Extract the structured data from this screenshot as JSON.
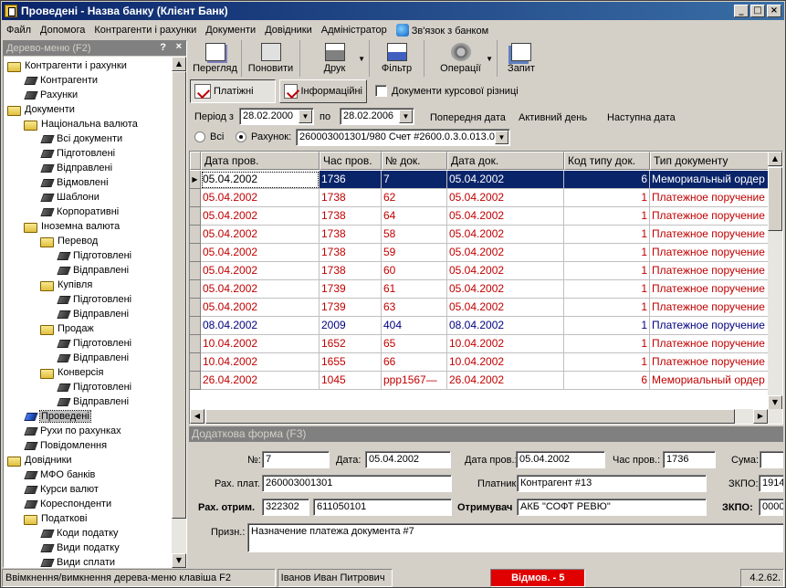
{
  "window": {
    "title": "Проведені - Назва банку (Клієнт Банк)",
    "buttons": [
      "_",
      "□",
      "×"
    ]
  },
  "menu": [
    "Файл",
    "Допомога",
    "Контрагенти і рахунки",
    "Документи",
    "Довідники",
    "Адміністратор",
    "Зв'язок з банком"
  ],
  "tree": {
    "header": "Дерево-меню (F2)",
    "help": "?",
    "close": "×",
    "items": [
      {
        "label": "Контрагенти і рахунки",
        "icon": "folder-icon",
        "level": 0
      },
      {
        "label": "Контрагенти",
        "icon": "book-icon",
        "level": 1
      },
      {
        "label": "Рахунки",
        "icon": "book-icon",
        "level": 1
      },
      {
        "label": "Документи",
        "icon": "folder-icon",
        "level": 0
      },
      {
        "label": "Національна валюта",
        "icon": "folder-icon",
        "level": 1
      },
      {
        "label": "Всі документи",
        "icon": "book-icon",
        "level": 2
      },
      {
        "label": "Підготовлені",
        "icon": "book-icon",
        "level": 2
      },
      {
        "label": "Відправлені",
        "icon": "book-icon",
        "level": 2
      },
      {
        "label": "Відмовлені",
        "icon": "book-icon",
        "level": 2
      },
      {
        "label": "Шаблони",
        "icon": "book-icon",
        "level": 2
      },
      {
        "label": "Корпоративні",
        "icon": "book-icon",
        "level": 2
      },
      {
        "label": "Іноземна валюта",
        "icon": "folder-icon",
        "level": 1
      },
      {
        "label": "Перевод",
        "icon": "folder-icon",
        "level": 2
      },
      {
        "label": "Підготовлені",
        "icon": "book-icon",
        "level": 3
      },
      {
        "label": "Відправлені",
        "icon": "book-icon",
        "level": 3
      },
      {
        "label": "Купівля",
        "icon": "folder-icon",
        "level": 2
      },
      {
        "label": "Підготовлені",
        "icon": "book-icon",
        "level": 3
      },
      {
        "label": "Відправлені",
        "icon": "book-icon",
        "level": 3
      },
      {
        "label": "Продаж",
        "icon": "folder-icon",
        "level": 2
      },
      {
        "label": "Підготовлені",
        "icon": "book-icon",
        "level": 3
      },
      {
        "label": "Відправлені",
        "icon": "book-icon",
        "level": 3
      },
      {
        "label": "Конверсія",
        "icon": "folder-icon",
        "level": 2
      },
      {
        "label": "Підготовлені",
        "icon": "book-icon",
        "level": 3
      },
      {
        "label": "Відправлені",
        "icon": "book-icon",
        "level": 3
      },
      {
        "label": "Проведені",
        "icon": "blue-book-icon",
        "level": 1,
        "selected": true
      },
      {
        "label": "Рухи по рахунках",
        "icon": "book-icon",
        "level": 1
      },
      {
        "label": "Повідомлення",
        "icon": "book-icon",
        "level": 1
      },
      {
        "label": "Довідники",
        "icon": "folder-icon",
        "level": 0
      },
      {
        "label": "МФО банків",
        "icon": "book-icon",
        "level": 1
      },
      {
        "label": "Курси валют",
        "icon": "book-icon",
        "level": 1
      },
      {
        "label": "Кореспонденти",
        "icon": "book-icon",
        "level": 1
      },
      {
        "label": "Податкові",
        "icon": "folder-icon",
        "level": 1
      },
      {
        "label": "Коди податку",
        "icon": "book-icon",
        "level": 2
      },
      {
        "label": "Види податку",
        "icon": "book-icon",
        "level": 2
      },
      {
        "label": "Види сплати",
        "icon": "book-icon",
        "level": 2
      }
    ]
  },
  "toolbar": {
    "view": "Перегляд",
    "refresh": "Поновити",
    "print": "Друк",
    "filter": "Фільтр",
    "operations": "Операції",
    "query": "Запит",
    "dropdown_arrow": "▼"
  },
  "filters": {
    "tab_payment": "Платіжні",
    "tab_info": "Інформаційні",
    "exchange_docs": "Документи курсової різниці",
    "period_from_label": "Період з",
    "period_from": "28.02.2000",
    "period_to_label": "по",
    "period_to": "28.02.2006",
    "prev_date": "Попередня дата",
    "active_day": "Активний день",
    "next_date": "Наступна дата",
    "all_label": "Всі",
    "account_label": "Рахунок:",
    "account_value": "260003001301/980 Счет #2600.0.3.0.013.0"
  },
  "grid": {
    "columns": [
      "Дата пров.",
      "Час пров.",
      "№ док.",
      "Дата док.",
      "Код типу док.",
      "Тип документу"
    ],
    "rows": [
      {
        "date_prov": "05.04.2002",
        "time_prov": "1736",
        "doc_no": "7",
        "date_doc": "05.04.2002",
        "type_code": "6",
        "doc_type": "Мемориальный ордер",
        "color": "blue",
        "selected": true
      },
      {
        "date_prov": "05.04.2002",
        "time_prov": "1738",
        "doc_no": "62",
        "date_doc": "05.04.2002",
        "type_code": "1",
        "doc_type": "Платежное поручение",
        "color": "red"
      },
      {
        "date_prov": "05.04.2002",
        "time_prov": "1738",
        "doc_no": "64",
        "date_doc": "05.04.2002",
        "type_code": "1",
        "doc_type": "Платежное поручение",
        "color": "red"
      },
      {
        "date_prov": "05.04.2002",
        "time_prov": "1738",
        "doc_no": "58",
        "date_doc": "05.04.2002",
        "type_code": "1",
        "doc_type": "Платежное поручение",
        "color": "red"
      },
      {
        "date_prov": "05.04.2002",
        "time_prov": "1738",
        "doc_no": "59",
        "date_doc": "05.04.2002",
        "type_code": "1",
        "doc_type": "Платежное поручение",
        "color": "red"
      },
      {
        "date_prov": "05.04.2002",
        "time_prov": "1738",
        "doc_no": "60",
        "date_doc": "05.04.2002",
        "type_code": "1",
        "doc_type": "Платежное поручение",
        "color": "red"
      },
      {
        "date_prov": "05.04.2002",
        "time_prov": "1739",
        "doc_no": "61",
        "date_doc": "05.04.2002",
        "type_code": "1",
        "doc_type": "Платежное поручение",
        "color": "red"
      },
      {
        "date_prov": "05.04.2002",
        "time_prov": "1739",
        "doc_no": "63",
        "date_doc": "05.04.2002",
        "type_code": "1",
        "doc_type": "Платежное поручение",
        "color": "red"
      },
      {
        "date_prov": "08.04.2002",
        "time_prov": "2009",
        "doc_no": "404",
        "date_doc": "08.04.2002",
        "type_code": "1",
        "doc_type": "Платежное поручение",
        "color": "blue"
      },
      {
        "date_prov": "10.04.2002",
        "time_prov": "1652",
        "doc_no": "65",
        "date_doc": "10.04.2002",
        "type_code": "1",
        "doc_type": "Платежное поручение",
        "color": "red"
      },
      {
        "date_prov": "10.04.2002",
        "time_prov": "1655",
        "doc_no": "66",
        "date_doc": "10.04.2002",
        "type_code": "1",
        "doc_type": "Платежное поручение",
        "color": "red"
      },
      {
        "date_prov": "26.04.2002",
        "time_prov": "1045",
        "doc_no": "ррр1567—",
        "date_doc": "26.04.2002",
        "type_code": "6",
        "doc_type": "Мемориальный ордер",
        "color": "red"
      }
    ]
  },
  "details": {
    "header": "Додаткова форма (F3)",
    "no_label": "№:",
    "no_value": "7",
    "date_label": "Дата:",
    "date_value": "05.04.2002",
    "date_prov_label": "Дата пров.:",
    "date_prov_value": "05.04.2002",
    "time_prov_label": "Час пров.:",
    "time_prov_value": "1736",
    "sum_label": "Сума:",
    "sum_value": "",
    "payer_acc_label": "Рах. плат.",
    "payer_acc_value": "260003001301",
    "payer_label": "Платник",
    "payer_value": "Контрагент #13",
    "payer_okpo_label": "ЗКПО:",
    "payer_okpo_value": "1914",
    "recv_acc_label": "Рах. отрим.",
    "recv_mfo_value": "322302",
    "recv_acc_value": "611050101",
    "recv_label": "Отримувач",
    "recv_value": "АКБ \"СОФТ РЕВЮ\"",
    "recv_okpo_label": "ЗКПО:",
    "recv_okpo_value": "0000",
    "purpose_label": "Призн.:",
    "purpose_value": "Назначение платежа документа #7"
  },
  "status": {
    "hint": "Ввімкнення/вимкнення дерева-меню клавіша  F2",
    "user": "Іванов Иван Питрович",
    "refused": "Відмов. - 5",
    "version": "4.2.62."
  },
  "colors": {
    "red_text": "#c00000",
    "blue_text": "#000080",
    "selection": "#0a246a",
    "refused_badge": "#e00000"
  }
}
